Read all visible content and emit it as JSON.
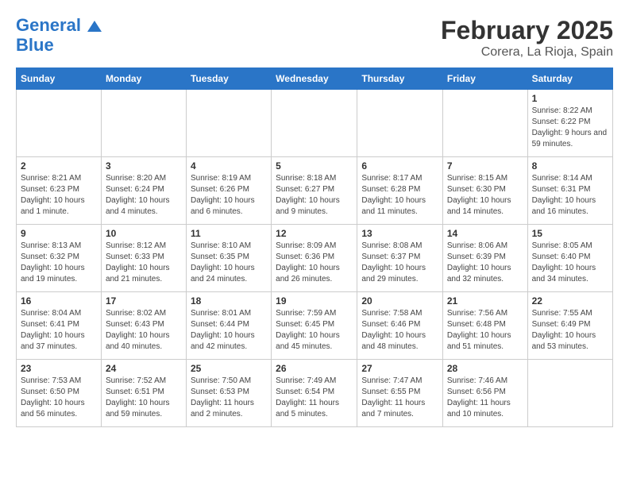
{
  "header": {
    "logo_line1": "General",
    "logo_line2": "Blue",
    "title": "February 2025",
    "subtitle": "Corera, La Rioja, Spain"
  },
  "weekdays": [
    "Sunday",
    "Monday",
    "Tuesday",
    "Wednesday",
    "Thursday",
    "Friday",
    "Saturday"
  ],
  "weeks": [
    [
      {
        "day": "",
        "info": ""
      },
      {
        "day": "",
        "info": ""
      },
      {
        "day": "",
        "info": ""
      },
      {
        "day": "",
        "info": ""
      },
      {
        "day": "",
        "info": ""
      },
      {
        "day": "",
        "info": ""
      },
      {
        "day": "1",
        "info": "Sunrise: 8:22 AM\nSunset: 6:22 PM\nDaylight: 9 hours and 59 minutes."
      }
    ],
    [
      {
        "day": "2",
        "info": "Sunrise: 8:21 AM\nSunset: 6:23 PM\nDaylight: 10 hours and 1 minute."
      },
      {
        "day": "3",
        "info": "Sunrise: 8:20 AM\nSunset: 6:24 PM\nDaylight: 10 hours and 4 minutes."
      },
      {
        "day": "4",
        "info": "Sunrise: 8:19 AM\nSunset: 6:26 PM\nDaylight: 10 hours and 6 minutes."
      },
      {
        "day": "5",
        "info": "Sunrise: 8:18 AM\nSunset: 6:27 PM\nDaylight: 10 hours and 9 minutes."
      },
      {
        "day": "6",
        "info": "Sunrise: 8:17 AM\nSunset: 6:28 PM\nDaylight: 10 hours and 11 minutes."
      },
      {
        "day": "7",
        "info": "Sunrise: 8:15 AM\nSunset: 6:30 PM\nDaylight: 10 hours and 14 minutes."
      },
      {
        "day": "8",
        "info": "Sunrise: 8:14 AM\nSunset: 6:31 PM\nDaylight: 10 hours and 16 minutes."
      }
    ],
    [
      {
        "day": "9",
        "info": "Sunrise: 8:13 AM\nSunset: 6:32 PM\nDaylight: 10 hours and 19 minutes."
      },
      {
        "day": "10",
        "info": "Sunrise: 8:12 AM\nSunset: 6:33 PM\nDaylight: 10 hours and 21 minutes."
      },
      {
        "day": "11",
        "info": "Sunrise: 8:10 AM\nSunset: 6:35 PM\nDaylight: 10 hours and 24 minutes."
      },
      {
        "day": "12",
        "info": "Sunrise: 8:09 AM\nSunset: 6:36 PM\nDaylight: 10 hours and 26 minutes."
      },
      {
        "day": "13",
        "info": "Sunrise: 8:08 AM\nSunset: 6:37 PM\nDaylight: 10 hours and 29 minutes."
      },
      {
        "day": "14",
        "info": "Sunrise: 8:06 AM\nSunset: 6:39 PM\nDaylight: 10 hours and 32 minutes."
      },
      {
        "day": "15",
        "info": "Sunrise: 8:05 AM\nSunset: 6:40 PM\nDaylight: 10 hours and 34 minutes."
      }
    ],
    [
      {
        "day": "16",
        "info": "Sunrise: 8:04 AM\nSunset: 6:41 PM\nDaylight: 10 hours and 37 minutes."
      },
      {
        "day": "17",
        "info": "Sunrise: 8:02 AM\nSunset: 6:43 PM\nDaylight: 10 hours and 40 minutes."
      },
      {
        "day": "18",
        "info": "Sunrise: 8:01 AM\nSunset: 6:44 PM\nDaylight: 10 hours and 42 minutes."
      },
      {
        "day": "19",
        "info": "Sunrise: 7:59 AM\nSunset: 6:45 PM\nDaylight: 10 hours and 45 minutes."
      },
      {
        "day": "20",
        "info": "Sunrise: 7:58 AM\nSunset: 6:46 PM\nDaylight: 10 hours and 48 minutes."
      },
      {
        "day": "21",
        "info": "Sunrise: 7:56 AM\nSunset: 6:48 PM\nDaylight: 10 hours and 51 minutes."
      },
      {
        "day": "22",
        "info": "Sunrise: 7:55 AM\nSunset: 6:49 PM\nDaylight: 10 hours and 53 minutes."
      }
    ],
    [
      {
        "day": "23",
        "info": "Sunrise: 7:53 AM\nSunset: 6:50 PM\nDaylight: 10 hours and 56 minutes."
      },
      {
        "day": "24",
        "info": "Sunrise: 7:52 AM\nSunset: 6:51 PM\nDaylight: 10 hours and 59 minutes."
      },
      {
        "day": "25",
        "info": "Sunrise: 7:50 AM\nSunset: 6:53 PM\nDaylight: 11 hours and 2 minutes."
      },
      {
        "day": "26",
        "info": "Sunrise: 7:49 AM\nSunset: 6:54 PM\nDaylight: 11 hours and 5 minutes."
      },
      {
        "day": "27",
        "info": "Sunrise: 7:47 AM\nSunset: 6:55 PM\nDaylight: 11 hours and 7 minutes."
      },
      {
        "day": "28",
        "info": "Sunrise: 7:46 AM\nSunset: 6:56 PM\nDaylight: 11 hours and 10 minutes."
      },
      {
        "day": "",
        "info": ""
      }
    ]
  ]
}
